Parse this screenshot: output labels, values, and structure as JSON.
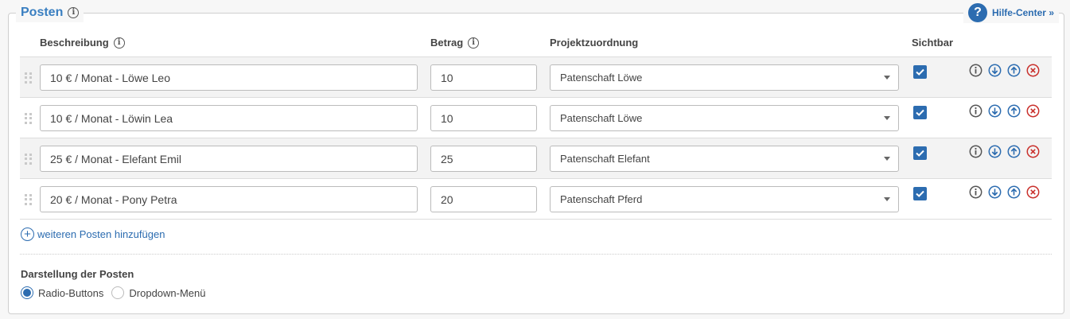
{
  "section": {
    "title": "Posten",
    "help_label": "Hilfe-Center »"
  },
  "columns": {
    "description": "Beschreibung",
    "amount": "Betrag",
    "project": "Projektzuordnung",
    "visible": "Sichtbar"
  },
  "rows": [
    {
      "description": "10 € / Monat - Löwe Leo",
      "amount": "10",
      "project": "Patenschaft Löwe",
      "visible": true
    },
    {
      "description": "10 € / Monat - Löwin Lea",
      "amount": "10",
      "project": "Patenschaft Löwe",
      "visible": true
    },
    {
      "description": "25 € / Monat - Elefant Emil",
      "amount": "25",
      "project": "Patenschaft Elefant",
      "visible": true
    },
    {
      "description": "20 € / Monat - Pony Petra",
      "amount": "20",
      "project": "Patenschaft Pferd",
      "visible": true
    }
  ],
  "add_item_label": "weiteren Posten hinzufügen",
  "display": {
    "title": "Darstellung der Posten",
    "options": [
      {
        "label": "Radio-Buttons",
        "selected": true
      },
      {
        "label": "Dropdown-Menü",
        "selected": false
      }
    ]
  },
  "colors": {
    "accent": "#2c6cb0",
    "danger": "#c9302c",
    "icon_gray": "#555555"
  },
  "icons": {
    "row_actions": [
      "info-icon",
      "move-down-icon",
      "move-up-icon",
      "delete-icon"
    ],
    "drag": "drag-handle-icon",
    "help": "question-mark-icon",
    "add": "plus-circle-icon"
  }
}
